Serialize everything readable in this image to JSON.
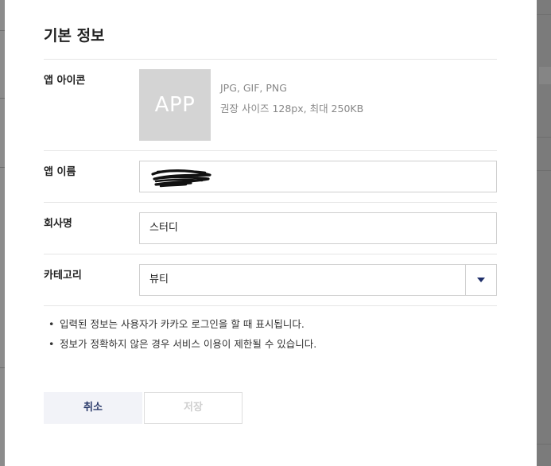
{
  "modal": {
    "title": "기본 정보",
    "app_icon": {
      "label": "앱 아이콘",
      "placeholder_text": "APP",
      "hint_formats": "JPG, GIF, PNG",
      "hint_size": "권장 사이즈 128px, 최대 250KB"
    },
    "app_name": {
      "label": "앱 이름",
      "value": ""
    },
    "company": {
      "label": "회사명",
      "value": "스터디"
    },
    "category": {
      "label": "카테고리",
      "selected": "뷰티"
    },
    "notes": [
      "입력된 정보는 사용자가 카카오 로그인을 할 때 표시됩니다.",
      "정보가 정확하지 않은 경우 서비스 이용이 제한될 수 있습니다."
    ],
    "bullet": "•",
    "buttons": {
      "cancel_label": "취소",
      "save_label": "저장"
    }
  },
  "colors": {
    "cancel_bg": "#f2f3f8",
    "cancel_text": "#2a3a6a",
    "select_arrow": "#1f2f6a",
    "icon_placeholder_bg": "#d4d4d4"
  },
  "icons": {
    "select_arrow": "caret-down-icon"
  }
}
